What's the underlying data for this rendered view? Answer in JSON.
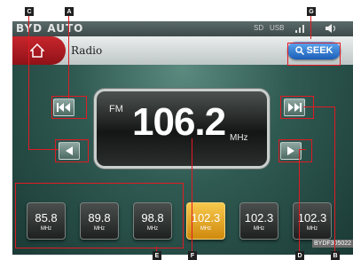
{
  "status_bar": {
    "brand": "BYD AUTO",
    "indicators": [
      "SD",
      "USB",
      "signal-icon",
      "volume-icon"
    ]
  },
  "header": {
    "home_icon": "home-icon",
    "title": "Radio",
    "seek_label": "SEEK",
    "seek_icon": "search-icon"
  },
  "tuner": {
    "band": "FM",
    "frequency": "106.2",
    "unit": "MHz"
  },
  "controls": {
    "prev_seek_icon": "skip-back-icon",
    "next_seek_icon": "skip-forward-icon",
    "step_down_icon": "triangle-left-icon",
    "step_up_icon": "triangle-right-icon"
  },
  "presets": [
    {
      "freq": "85.8",
      "unit": "MHz",
      "selected": false
    },
    {
      "freq": "89.8",
      "unit": "MHz",
      "selected": false
    },
    {
      "freq": "98.8",
      "unit": "MHz",
      "selected": false
    },
    {
      "freq": "102.3",
      "unit": "MHz",
      "selected": true
    },
    {
      "freq": "102.3",
      "unit": "MHz",
      "selected": false
    },
    {
      "freq": "102.3",
      "unit": "MHz",
      "selected": false
    }
  ],
  "callouts": [
    "A",
    "B",
    "C",
    "D",
    "E",
    "F",
    "G"
  ],
  "watermark": "BYDF305022",
  "colors": {
    "callout_line": "#e01b24",
    "seek_button": "#1c5fb8",
    "home_button": "#c8262d",
    "selected_preset": "#f0b838"
  }
}
